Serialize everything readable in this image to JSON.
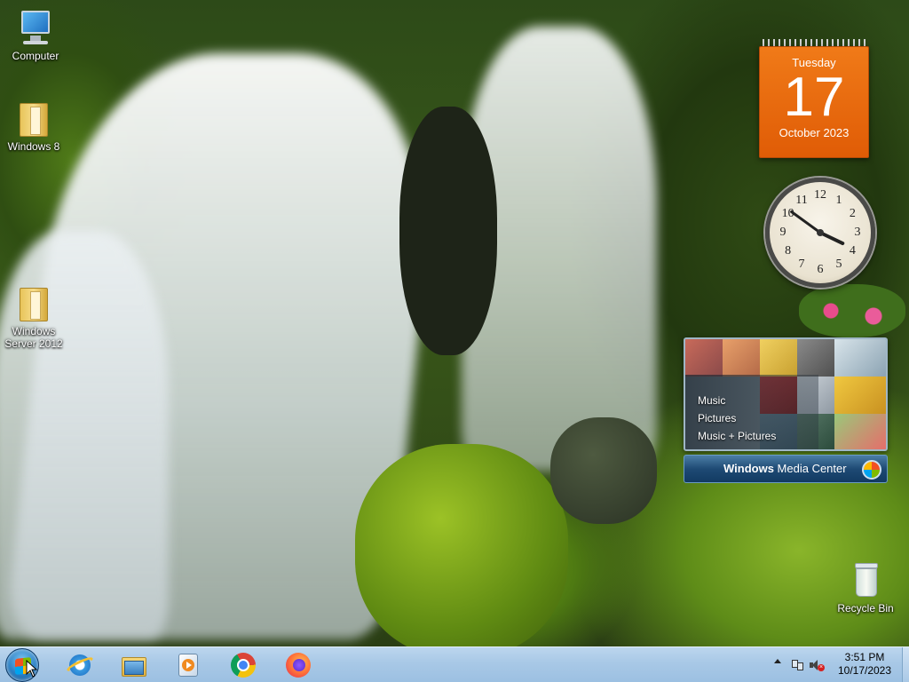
{
  "desktop": {
    "icons": [
      {
        "label": "Computer",
        "icon": "computer-icon"
      },
      {
        "label": "Windows 8",
        "icon": "folder-icon"
      },
      {
        "label": "Windows Server 2012",
        "icon": "folder-icon"
      },
      {
        "label": "Recycle Bin",
        "icon": "recycle-bin-icon"
      }
    ]
  },
  "gadgets": {
    "calendar": {
      "weekday": "Tuesday",
      "day": "17",
      "month_year": "October 2023"
    },
    "clock": {
      "hour": 3,
      "minute": 51,
      "numerals": [
        "12",
        "1",
        "2",
        "3",
        "4",
        "5",
        "6",
        "7",
        "8",
        "9",
        "10",
        "11"
      ]
    },
    "media_center": {
      "items": [
        "Music",
        "Pictures",
        "Music + Pictures"
      ],
      "brand_strong": "Windows",
      "brand_rest": " Media Center"
    }
  },
  "taskbar": {
    "start": "start-orb",
    "pinned": [
      {
        "name": "Internet Explorer",
        "icon": "internet-explorer-icon"
      },
      {
        "name": "File Explorer",
        "icon": "file-explorer-icon"
      },
      {
        "name": "Windows Media Player",
        "icon": "media-player-icon"
      },
      {
        "name": "Google Chrome",
        "icon": "chrome-icon"
      },
      {
        "name": "Firefox",
        "icon": "firefox-icon"
      }
    ],
    "tray": {
      "icons": [
        "show-hidden-icons",
        "network-icon",
        "volume-muted-icon"
      ],
      "time": "3:51 PM",
      "date": "10/17/2023"
    }
  },
  "colors": {
    "calendar_orange": "#e86a10",
    "taskbar": "#a8c8e6",
    "media_center_bar": "#1e4a74"
  }
}
